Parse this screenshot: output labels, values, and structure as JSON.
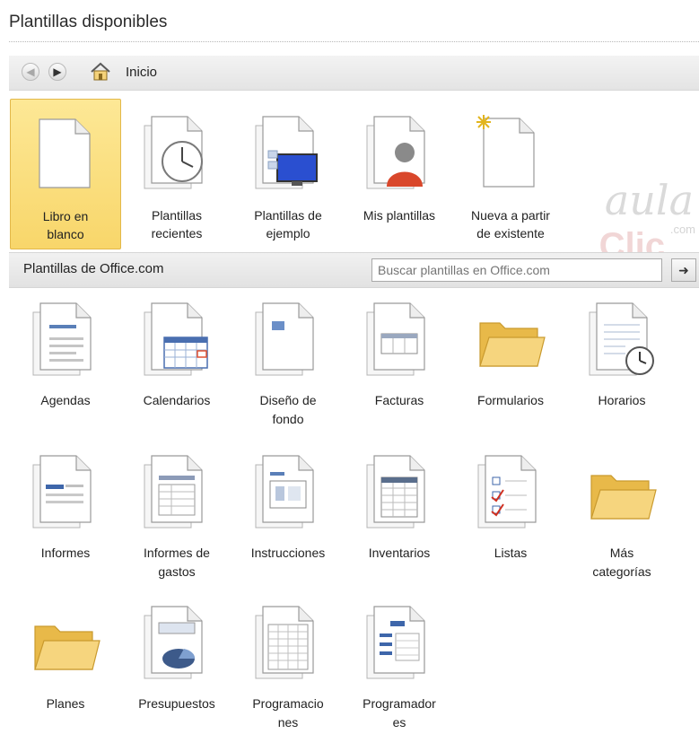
{
  "header": {
    "title": "Plantillas disponibles"
  },
  "nav": {
    "back_icon": "back-arrow-icon",
    "forward_icon": "forward-arrow-icon",
    "home_label": "Inicio"
  },
  "top_items": [
    {
      "label_line1": "Libro en",
      "label_line2": "blanco",
      "icon": "blank-document-icon",
      "selected": true
    },
    {
      "label_line1": "Plantillas",
      "label_line2": "recientes",
      "icon": "clock-document-icon"
    },
    {
      "label_line1": "Plantillas de",
      "label_line2": "ejemplo",
      "icon": "sample-monitor-icon"
    },
    {
      "label_line1": "Mis plantillas",
      "label_line2": "",
      "icon": "user-document-icon"
    },
    {
      "label_line1": "Nueva a partir",
      "label_line2": "de existente",
      "icon": "new-from-existing-icon"
    }
  ],
  "office_section": {
    "label": "Plantillas de Office.com",
    "search_placeholder": "Buscar plantillas en Office.com",
    "search_button_icon": "arrow-right-icon"
  },
  "categories": [
    {
      "line1": "Agendas",
      "line2": "",
      "icon": "agenda-document-icon"
    },
    {
      "line1": "Calendarios",
      "line2": "",
      "icon": "calendar-document-icon"
    },
    {
      "line1": "Diseño de",
      "line2": "fondo",
      "icon": "background-document-icon"
    },
    {
      "line1": "Facturas",
      "line2": "",
      "icon": "invoice-document-icon"
    },
    {
      "line1": "Formularios",
      "line2": "",
      "icon": "folder-icon"
    },
    {
      "line1": "Horarios",
      "line2": "",
      "icon": "schedule-clock-icon"
    },
    {
      "line1": "Informes",
      "line2": "",
      "icon": "report-document-icon"
    },
    {
      "line1": "Informes de",
      "line2": "gastos",
      "icon": "expense-report-icon"
    },
    {
      "line1": "Instrucciones",
      "line2": "",
      "icon": "instructions-document-icon"
    },
    {
      "line1": "Inventarios",
      "line2": "",
      "icon": "inventory-document-icon"
    },
    {
      "line1": "Listas",
      "line2": "",
      "icon": "checklist-document-icon"
    },
    {
      "line1": "Más",
      "line2": "categorías",
      "icon": "folder-icon"
    },
    {
      "line1": "Planes",
      "line2": "",
      "icon": "folder-icon"
    },
    {
      "line1": "Presupuestos",
      "line2": "",
      "icon": "budget-pie-document-icon"
    },
    {
      "line1": "Programacio",
      "line2": "nes",
      "icon": "programming-spreadsheet-icon"
    },
    {
      "line1": "Programador",
      "line2": "es",
      "icon": "planner-document-icon"
    }
  ],
  "watermark": {
    "line1": "aula",
    "line2": "Clic",
    "suffix": ".com"
  }
}
